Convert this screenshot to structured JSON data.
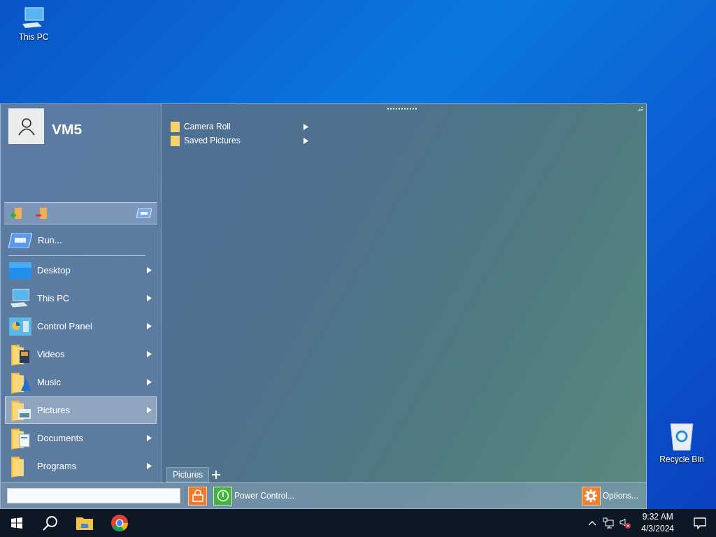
{
  "desktop_icons": [
    {
      "label": "This PC",
      "kind": "computer"
    },
    {
      "label": "Recycle Bin",
      "kind": "bin"
    }
  ],
  "start_menu": {
    "user": "VM5",
    "run": "Run...",
    "items": [
      {
        "label": "Desktop",
        "kind": "desktop",
        "selected": false
      },
      {
        "label": "This PC",
        "kind": "computer",
        "selected": false
      },
      {
        "label": "Control Panel",
        "kind": "panel",
        "selected": false
      },
      {
        "label": "Videos",
        "kind": "videos",
        "selected": false
      },
      {
        "label": "Music",
        "kind": "music",
        "selected": false
      },
      {
        "label": "Pictures",
        "kind": "pictures",
        "selected": true
      },
      {
        "label": "Documents",
        "kind": "documents",
        "selected": false
      },
      {
        "label": "Programs",
        "kind": "folder",
        "selected": false
      }
    ],
    "submenu": [
      "Camera Roll",
      "Saved Pictures"
    ],
    "tabs": [
      {
        "label": "Pictures",
        "selected": true
      }
    ],
    "power": "Power Control...",
    "options": "Options..."
  },
  "taskbar": {
    "time": "9:32 AM",
    "date": "4/3/2024"
  }
}
